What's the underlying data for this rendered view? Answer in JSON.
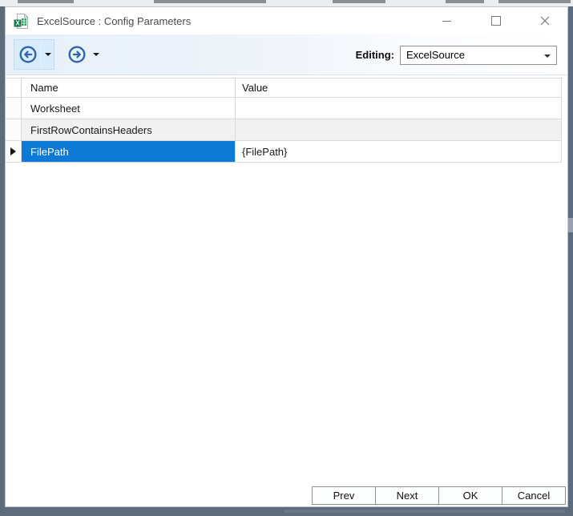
{
  "window": {
    "title": "ExcelSource : Config Parameters",
    "app_icon": "excel-file-icon",
    "controls": [
      {
        "name": "minimize"
      },
      {
        "name": "maximize"
      },
      {
        "name": "close"
      }
    ]
  },
  "toolbar": {
    "back_button_icon": "circle-arrow-left",
    "forward_button_icon": "circle-arrow-right",
    "dropdown_glyph": "▾",
    "editing_label": "Editing:",
    "editing_value": "ExcelSource"
  },
  "grid": {
    "columns": [
      "Name",
      "Value"
    ],
    "rows": [
      {
        "name": "Worksheet",
        "value": "",
        "selected": false
      },
      {
        "name": "FirstRowContainsHeaders",
        "value": "",
        "selected": false
      },
      {
        "name": "FilePath",
        "value": "{FilePath}",
        "selected": true
      }
    ],
    "current_row_indicator": "▶"
  },
  "footer": {
    "buttons": [
      "Prev",
      "Next",
      "OK",
      "Cancel"
    ]
  },
  "colors": {
    "selection_blue": "#0d7ad6",
    "nav_icon_blue": "#2e65ad",
    "backdrop_slate": "#5d6b7a",
    "toolbar_tint": "#e8f1f9"
  }
}
